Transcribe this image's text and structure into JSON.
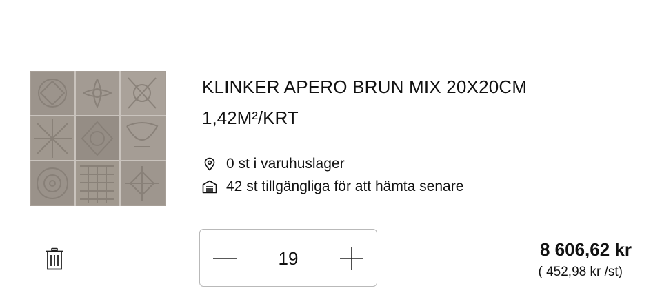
{
  "product": {
    "title": "KLINKER APERO BRUN MIX 20X20CM",
    "subtitle": "1,42M²/KRT",
    "image_icon": "tile-pattern-thumbnail"
  },
  "stock": {
    "store": {
      "icon": "location-pin-icon",
      "text": "0 st i varuhuslager"
    },
    "pickup": {
      "icon": "warehouse-icon",
      "text": "42 st tillgängliga för att hämta senare"
    }
  },
  "quantity": {
    "value": "19",
    "decrement_icon": "minus-icon",
    "increment_icon": "plus-icon"
  },
  "price": {
    "total": "8 606,62 kr",
    "unit": "( 452,98 kr /st)"
  },
  "actions": {
    "delete_icon": "trash-icon"
  }
}
